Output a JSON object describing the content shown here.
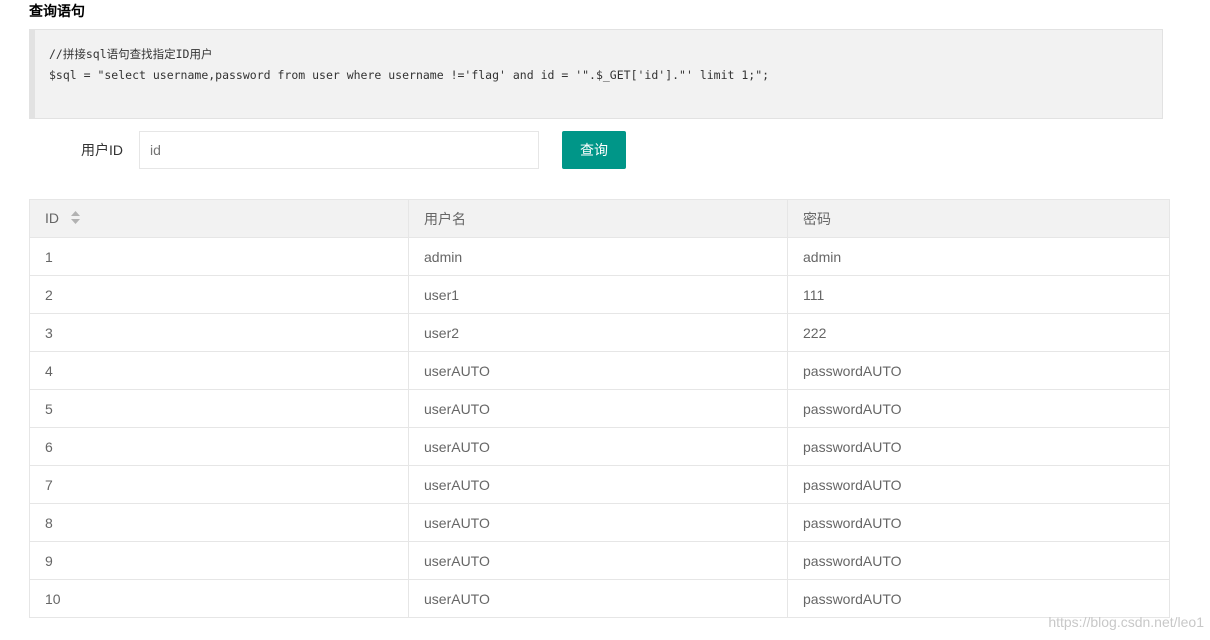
{
  "section_title": "查询语句",
  "code": {
    "line1": "//拼接sql语句查找指定ID用户",
    "line2": "$sql = \"select username,password from user where username !='flag' and id = '\".$_GET['id'].\"' limit 1;\";"
  },
  "form": {
    "label": "用户ID",
    "input_placeholder": "id",
    "input_value": "",
    "button_label": "查询"
  },
  "table": {
    "columns": [
      "ID",
      "用户名",
      "密码"
    ],
    "rows": [
      [
        "1",
        "admin",
        "admin"
      ],
      [
        "2",
        "user1",
        "111"
      ],
      [
        "3",
        "user2",
        "222"
      ],
      [
        "4",
        "userAUTO",
        "passwordAUTO"
      ],
      [
        "5",
        "userAUTO",
        "passwordAUTO"
      ],
      [
        "6",
        "userAUTO",
        "passwordAUTO"
      ],
      [
        "7",
        "userAUTO",
        "passwordAUTO"
      ],
      [
        "8",
        "userAUTO",
        "passwordAUTO"
      ],
      [
        "9",
        "userAUTO",
        "passwordAUTO"
      ],
      [
        "10",
        "userAUTO",
        "passwordAUTO"
      ]
    ]
  },
  "watermark": "https://blog.csdn.net/leo1",
  "colors": {
    "accent": "#009688",
    "header_bg": "#f2f2f2",
    "code_bg": "#f2f2f2",
    "border": "#e6e6e6"
  },
  "icons": {
    "sort": "sort-icon"
  }
}
